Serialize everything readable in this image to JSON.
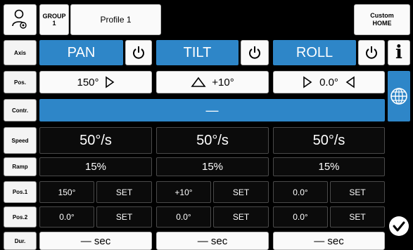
{
  "header": {
    "group_label": "GROUP\n1",
    "profile_label": "Profile 1",
    "custom_home_label": "Custom\nHOME"
  },
  "labels": {
    "axis": "Axis",
    "pos": "Pos.",
    "contr": "Contr.",
    "speed": "Speed",
    "ramp": "Ramp",
    "pos1": "Pos.1",
    "pos2": "Pos.2",
    "dur": "Dur."
  },
  "axes": [
    {
      "name": "PAN",
      "pos": "150°",
      "speed": "50°/s",
      "ramp": "15%",
      "pos1": "150°",
      "pos2": "0.0°",
      "set": "SET",
      "dur": "— sec"
    },
    {
      "name": "TILT",
      "pos": "+10°",
      "speed": "50°/s",
      "ramp": "15%",
      "pos1": "+10°",
      "pos2": "0.0°",
      "set": "SET",
      "dur": "— sec"
    },
    {
      "name": "ROLL",
      "pos": "0.0°",
      "speed": "50°/s",
      "ramp": "15%",
      "pos1": "0.0°",
      "pos2": "0.0°",
      "set": "SET",
      "dur": "— sec"
    }
  ],
  "controller": {
    "value": "—"
  },
  "info_label": "i",
  "colors": {
    "accent_blue": "#2e86c8",
    "panel_dark": "#0b0b0b",
    "cell_white": "#fafafa"
  },
  "icons": [
    "user-settings-icon",
    "power-icon",
    "globe-icon",
    "checkmark-icon",
    "triangle-right-icon",
    "triangle-up-icon",
    "triangle-left-icon"
  ]
}
